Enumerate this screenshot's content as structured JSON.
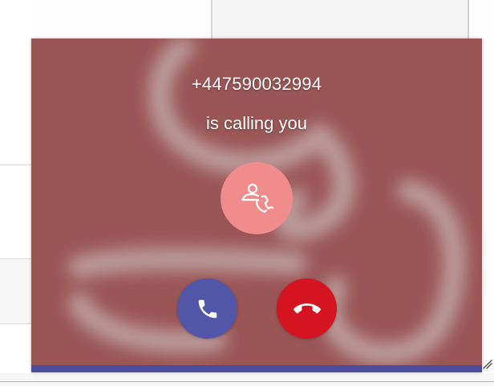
{
  "call": {
    "caller_number": "+447590032994",
    "status_text": "is calling you"
  },
  "icons": {
    "caller_avatar": "phone-handset-person-icon",
    "accept": "phone-icon",
    "decline": "hang-up-icon",
    "resize": "resize-grip-icon"
  },
  "colors": {
    "window_background": "#9a5555",
    "avatar_circle": "#f08c8c",
    "accept_button": "#5156a8",
    "decline_button": "#d41420",
    "bottom_bar": "#4c4e9c"
  }
}
